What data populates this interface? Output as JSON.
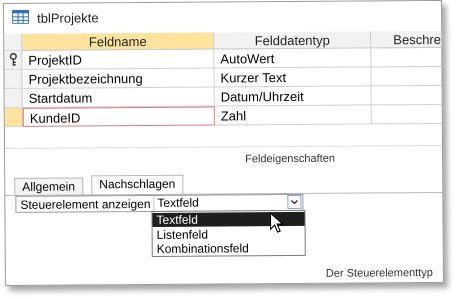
{
  "window": {
    "title": "tblProjekte",
    "icon": "table-icon"
  },
  "grid": {
    "columns": [
      "Feldname",
      "Felddatentyp",
      "Beschreibung"
    ],
    "rows": [
      {
        "field": "ProjektID",
        "type": "AutoWert",
        "primary_key": true
      },
      {
        "field": "Projektbezeichnung",
        "type": "Kurzer Text"
      },
      {
        "field": "Startdatum",
        "type": "Datum/Uhrzeit"
      },
      {
        "field": "KundeID",
        "type": "Zahl",
        "current": true
      }
    ]
  },
  "properties": {
    "section_label": "Feldeigenschaften",
    "tabs": [
      {
        "label": "Allgemein",
        "active": false
      },
      {
        "label": "Nachschlagen",
        "active": true
      }
    ],
    "row": {
      "name": "Steuerelement anzeigen",
      "value": "Textfeld"
    },
    "dropdown": {
      "options": [
        "Textfeld",
        "Listenfeld",
        "Kombinationsfeld"
      ],
      "selected": "Textfeld"
    },
    "footnote": "Der Steuerelementtyp"
  },
  "colors": {
    "accent": "#fde39d",
    "current_border": "#e07a7a",
    "dropdown_selected": "#1e1e1e"
  }
}
